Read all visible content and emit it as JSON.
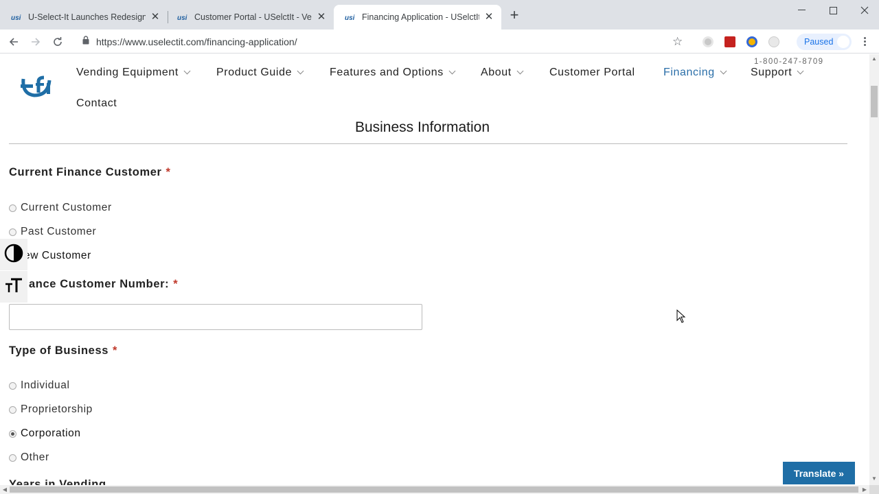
{
  "browser": {
    "tabs": [
      {
        "title": "U-Select-It Launches Redesigned",
        "active": false
      },
      {
        "title": "Customer Portal - USelctIt - Vend",
        "active": false
      },
      {
        "title": "Financing Application - USelctIt -",
        "active": true
      }
    ],
    "url": "https://www.uselectit.com/financing-application/",
    "profile_label": "Paused"
  },
  "site": {
    "phone": "1-800-247-8709",
    "nav": [
      {
        "label": "Vending Equipment",
        "dropdown": true
      },
      {
        "label": "Product Guide",
        "dropdown": true
      },
      {
        "label": "Features and Options",
        "dropdown": true
      },
      {
        "label": "About",
        "dropdown": true
      },
      {
        "label": "Customer Portal",
        "dropdown": false
      },
      {
        "label": "Financing",
        "dropdown": true,
        "active": true
      },
      {
        "label": "Support",
        "dropdown": true
      },
      {
        "label": "Contact",
        "dropdown": false
      }
    ]
  },
  "form": {
    "section_title": "Business Information",
    "current_customer": {
      "label": "Current Finance Customer",
      "required": "*",
      "options": [
        "Current Customer",
        "Past Customer",
        "ew Customer"
      ]
    },
    "customer_number": {
      "label": "ance Customer Number:",
      "required": "*",
      "value": ""
    },
    "business_type": {
      "label": "Type of Business",
      "required": "*",
      "options": [
        "Individual",
        "Proprietorship",
        "Corporation",
        "Other"
      ],
      "selected": "Corporation"
    },
    "next_label_partial": "Years in Vending"
  },
  "widgets": {
    "translate_label": "Translate »"
  },
  "colors": {
    "brand": "#1f6ea6",
    "nav_active": "#2a6ea8",
    "required": "#c0392b"
  }
}
